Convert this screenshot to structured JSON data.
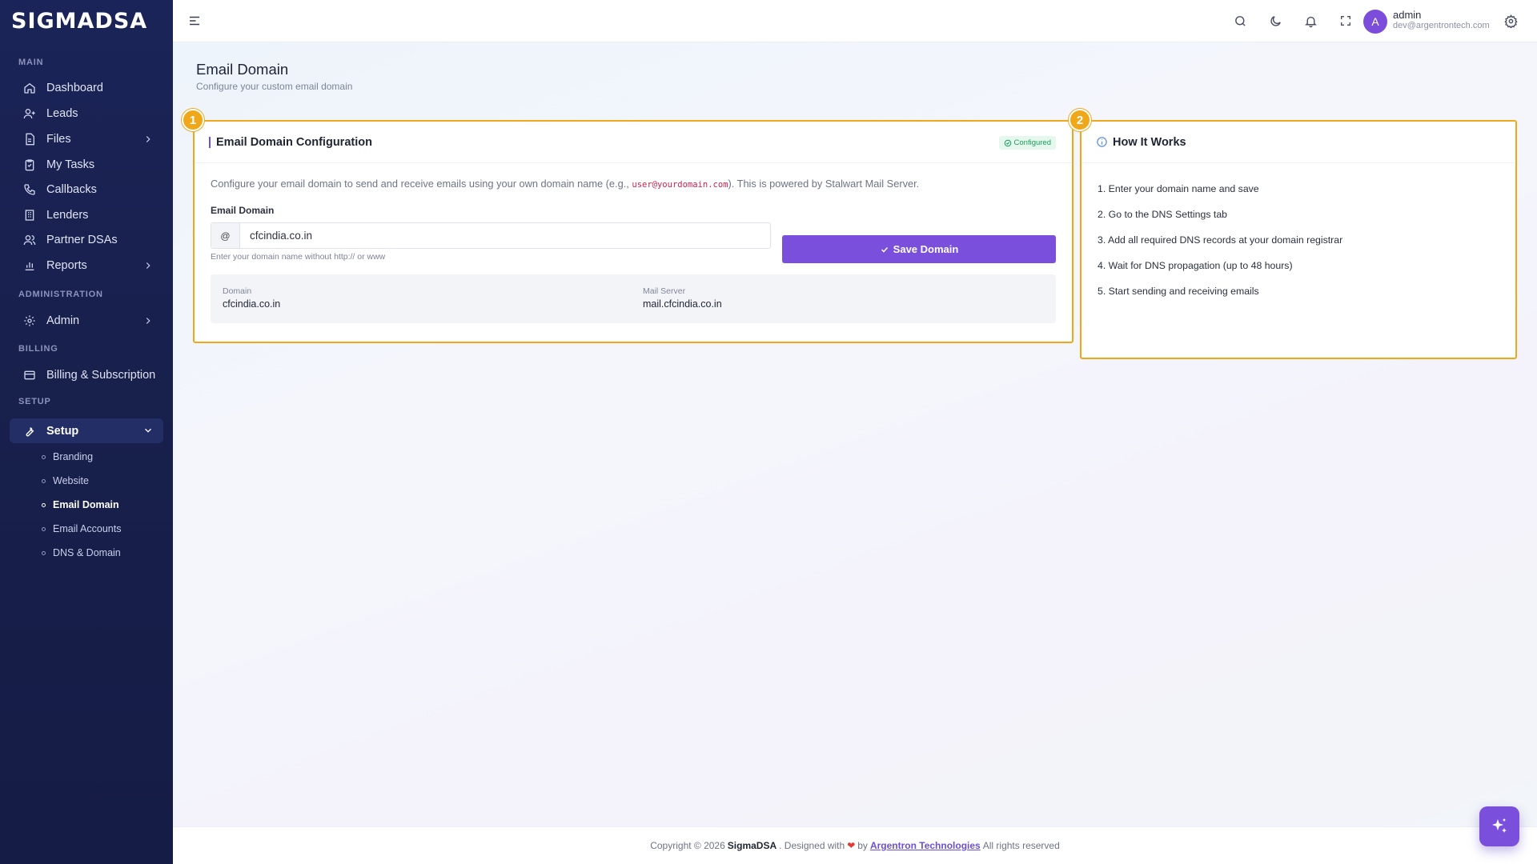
{
  "brand": {
    "logo_text": "SIGMADSA"
  },
  "sidebar": {
    "sections": {
      "main": "MAIN",
      "administration": "ADMINISTRATION",
      "billing": "BILLING",
      "setup": "SETUP"
    },
    "items": {
      "dashboard": "Dashboard",
      "leads": "Leads",
      "files": "Files",
      "my_tasks": "My Tasks",
      "callbacks": "Callbacks",
      "lenders": "Lenders",
      "partner_dsas": "Partner DSAs",
      "reports": "Reports",
      "admin": "Admin",
      "billing": "Billing & Subscription",
      "setup": "Setup"
    },
    "setup_sub": {
      "branding": "Branding",
      "website": "Website",
      "email_domain": "Email Domain",
      "email_accounts": "Email Accounts",
      "dns_domain": "DNS & Domain"
    }
  },
  "topbar": {
    "user_initial": "A",
    "user_name": "admin",
    "user_email": "dev@argentrontech.com"
  },
  "page": {
    "title": "Email Domain",
    "subtitle": "Configure your custom email domain"
  },
  "config_card": {
    "step": "1",
    "title": "Email Domain Configuration",
    "status_badge": "Configured",
    "description_before": "Configure your email domain to send and receive emails using your own domain name (e.g., ",
    "description_code": "user@yourdomain.com",
    "description_after": "). This is powered by Stalwart Mail Server.",
    "field_label": "Email Domain",
    "input_prefix": "@",
    "input_value": "cfcindia.co.in",
    "help_text": "Enter your domain name without http:// or www",
    "save_label": "Save Domain",
    "domain_label": "Domain",
    "domain_value": "cfcindia.co.in",
    "mail_server_label": "Mail Server",
    "mail_server_value": "mail.cfcindia.co.in"
  },
  "how_card": {
    "step": "2",
    "title": "How It Works",
    "steps": [
      "1. Enter your domain name and save",
      "2. Go to the DNS Settings tab",
      "3. Add all required DNS records at your domain registrar",
      "4. Wait for DNS propagation (up to 48 hours)",
      "5. Start sending and receiving emails"
    ]
  },
  "footer": {
    "copyright": "Copyright © 2026",
    "brand": "SigmaDSA",
    "designed_with": ". Designed with",
    "by": "by",
    "company": "Argentron Technologies",
    "rights": "All rights reserved"
  },
  "colors": {
    "accent": "#7a4fdb",
    "highlight": "#f0a81a",
    "sidebar_bg": "#18204d",
    "success": "#1a9d5b"
  }
}
